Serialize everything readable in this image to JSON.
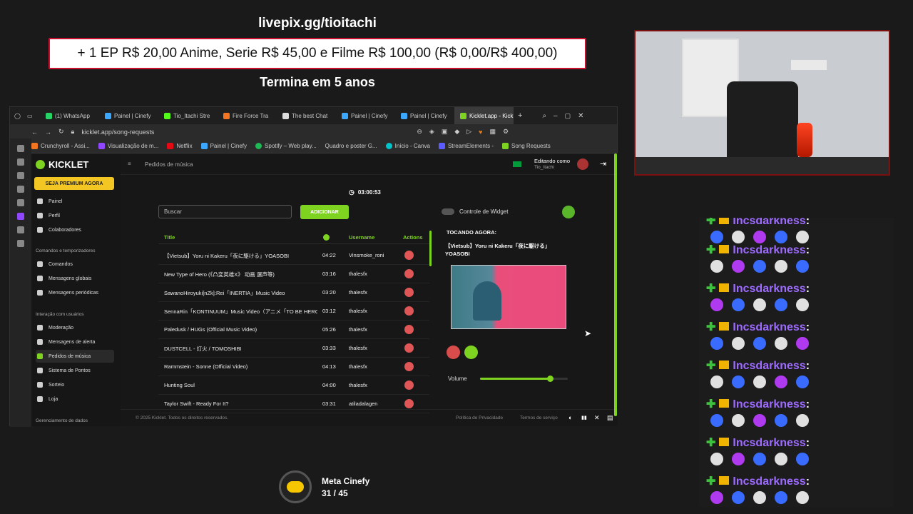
{
  "overlay": {
    "livepix": "livepix.gg/tioitachi",
    "goal": "+ 1 EP R$ 20,00 Anime, Serie R$ 45,00 e Filme R$ 100,00 (R$ 0,00/R$ 400,00)",
    "ends": "Termina em 5 anos"
  },
  "browser": {
    "tabs": [
      "(1) WhatsApp",
      "Painel | Cinefy",
      "Tio_Itachi Stre",
      "Fire Force Tra",
      "The best Chat",
      "Painel | Cinefy",
      "Painel | Cinefy",
      "Kicklet.app - Kick Cha"
    ],
    "url": "kicklet.app/song-requests",
    "bookmarks": [
      "Crunchyroll - Assi...",
      "Visualização de m...",
      "Netflix",
      "Painel | Cinefy",
      "Spotify – Web play...",
      "Quadro e poster G...",
      "Início - Canva",
      "StreamElements -",
      "Song Requests"
    ]
  },
  "kicklet": {
    "logo": "KICKLET",
    "premium": "SEJA PREMIUM AGORA",
    "nav": [
      "Painel",
      "Perfil",
      "Colaboradores"
    ],
    "section1": "Comandos e temporizadores",
    "nav2": [
      "Comandos",
      "Mensagens globais",
      "Mensagens periódicas"
    ],
    "section2": "Interação com usuários",
    "nav3": [
      "Moderação",
      "Mensagens de alerta",
      "Pedidos de música",
      "Sistema de Pontos",
      "Sorteio",
      "Loja"
    ],
    "section3": "Gerenciamento de dados",
    "page_title": "Pedidos de música",
    "editing_label": "Editando como",
    "editing_user": "Tio_Itachi",
    "timer": "03:00:53",
    "search_placeholder": "Buscar",
    "add_label": "ADICIONAR",
    "widget_label": "Controle de Widget",
    "col_title": "Title",
    "col_username": "Username",
    "col_actions": "Actions",
    "songs": [
      {
        "title": "【Vietsub】Yoru ni Kakeru「夜に駆ける」YOASOBI",
        "dur": "04:22",
        "user": "Vinsmoke_roni"
      },
      {
        "title": "New Type of Hero (《凸変英雄X》 动画 選声等)",
        "dur": "03:16",
        "user": "thalesfx"
      },
      {
        "title": "SawanoHiroyuki[nZk]:Rei「INERTIA」Music Video",
        "dur": "03:20",
        "user": "thalesfx"
      },
      {
        "title": "SennaRin「KONTINUUM」Music Video（アニメ「TO BE HERO X」エンディングテーマ）",
        "dur": "03:12",
        "user": "thalesfx"
      },
      {
        "title": "Paledusk / HUGs (Official Music Video)",
        "dur": "05:26",
        "user": "thalesfx"
      },
      {
        "title": "DUSTCELL - 灯火 / TOMOSHIBI",
        "dur": "03:33",
        "user": "thalesfx"
      },
      {
        "title": "Rammstein - Sonne (Official Video)",
        "dur": "04:13",
        "user": "thalesfx"
      },
      {
        "title": "Hunting Soul",
        "dur": "04:00",
        "user": "thalesfx"
      },
      {
        "title": "Taylor Swift - Ready For It?",
        "dur": "03:31",
        "user": "atiladalagen"
      }
    ],
    "now_playing_label": "TOCANDO AGORA:",
    "now_playing": "【Vietsub】Yoru ni Kakeru「夜に駆ける」YOASOBI",
    "volume_label": "Volume",
    "volume": 0.8,
    "footer": "© 2025 Kicklet. Todos os direitos reservados.",
    "privacy": "Política de Privacidade",
    "terms": "Termos de serviço"
  },
  "chat": {
    "user": "Incsdarkness",
    "sep": ":",
    "partial": "Incsdarkness :"
  },
  "meta": {
    "name": "Meta Cinefy",
    "count": "31 / 45"
  },
  "colors": {
    "accent": "#7ed321",
    "premium": "#f3c624",
    "chatname": "#9d6bff",
    "goalborder": "#c8102e"
  }
}
